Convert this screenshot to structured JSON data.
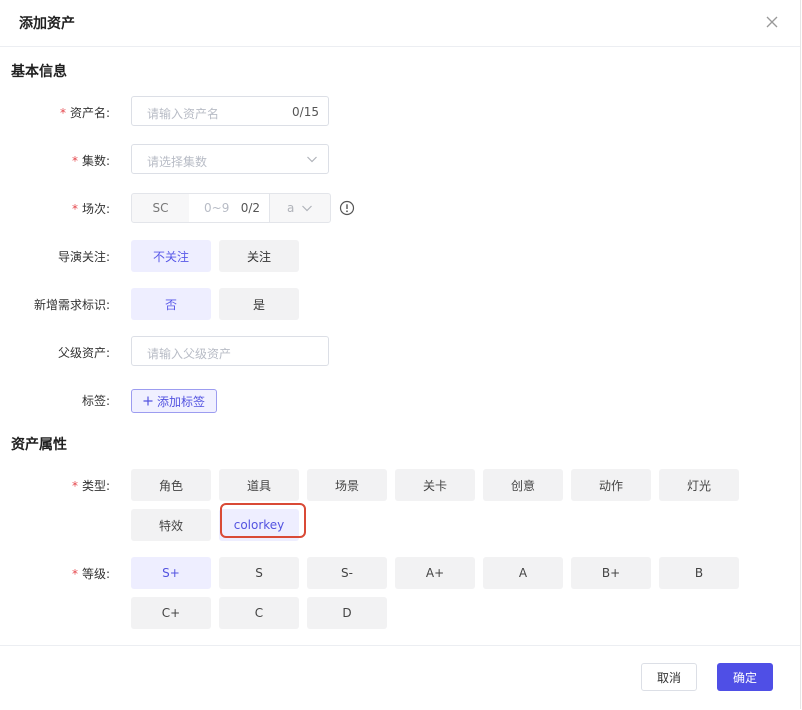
{
  "modal": {
    "title": "添加资产",
    "close_icon": "close-icon"
  },
  "basic_section": {
    "title": "基本信息",
    "asset_name": {
      "required_mark": "*",
      "label": "资产名:",
      "placeholder": "请输入资产名",
      "count": "0/15"
    },
    "episode": {
      "required_mark": "*",
      "label": "集数:",
      "placeholder": "请选择集数",
      "icon": "chevron-down-icon"
    },
    "scene": {
      "required_mark": "*",
      "label": "场次:",
      "prefix": "SC",
      "placeholder": "0~9",
      "count": "0/2",
      "suffix_value": "a",
      "icon": "info-icon"
    },
    "director_focus": {
      "label": "导演关注:",
      "options": [
        "不关注",
        "关注"
      ],
      "selected": "不关注"
    },
    "new_demand": {
      "label": "新增需求标识:",
      "options": [
        "否",
        "是"
      ],
      "selected": "否"
    },
    "parent_asset": {
      "label": "父级资产:",
      "placeholder": "请输入父级资产"
    },
    "tags": {
      "label": "标签:",
      "add_button": "添加标签",
      "icon": "plus-icon"
    }
  },
  "attr_section": {
    "title": "资产属性",
    "type": {
      "required_mark": "*",
      "label": "类型:",
      "options": [
        "角色",
        "道具",
        "场景",
        "关卡",
        "创意",
        "动作",
        "灯光",
        "特效",
        "colorkey"
      ],
      "selected": "colorkey"
    },
    "level": {
      "required_mark": "*",
      "label": "等级:",
      "options": [
        "S+",
        "S",
        "S-",
        "A+",
        "A",
        "B+",
        "B",
        "C+",
        "C",
        "D"
      ],
      "selected": "S+"
    }
  },
  "footer": {
    "cancel": "取消",
    "confirm": "确定"
  },
  "colors": {
    "accent": "#4f4fe6",
    "selected_bg": "#eeeeff",
    "required": "#e5484d",
    "highlight_box": "#d94a36"
  }
}
